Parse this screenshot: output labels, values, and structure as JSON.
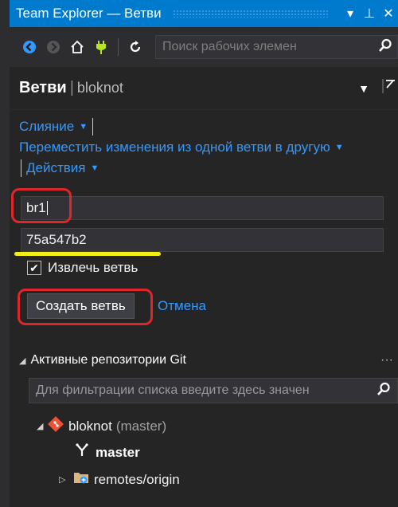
{
  "window": {
    "title": "Team Explorer — Ветви",
    "buttons": {
      "menu": "▾",
      "pin": "⊥",
      "close": "✕"
    }
  },
  "toolbar": {
    "search_placeholder": "Поиск рабочих элемен",
    "icons": [
      "back-icon",
      "forward-icon",
      "home-icon",
      "connect-icon",
      "refresh-icon",
      "search-icon"
    ]
  },
  "header": {
    "title": "Ветви",
    "separator": "|",
    "repo": "bloknot"
  },
  "actions": {
    "merge": "Слияние",
    "move_changes": "Переместить изменения из одной ветви в другую",
    "actions": "Действия"
  },
  "form": {
    "branch_name": "br1",
    "commit_id": "75a547b2",
    "checkout_label": "Извлечь ветвь",
    "checkout_checked": true,
    "create_button": "Создать ветвь",
    "cancel_link": "Отмена"
  },
  "repos": {
    "section_title": "Активные репозитории Git",
    "more": "···",
    "filter_placeholder": "Для фильтрации списка введите здесь значен",
    "tree": [
      {
        "name": "bloknot",
        "suffix": "(master)"
      },
      {
        "name": "master"
      },
      {
        "name": "remotes/origin"
      }
    ]
  },
  "colors": {
    "accent": "#007acc",
    "link": "#3399ff",
    "highlight_red": "#e0252b",
    "highlight_yellow": "#f4ec16",
    "background": "#252526"
  }
}
